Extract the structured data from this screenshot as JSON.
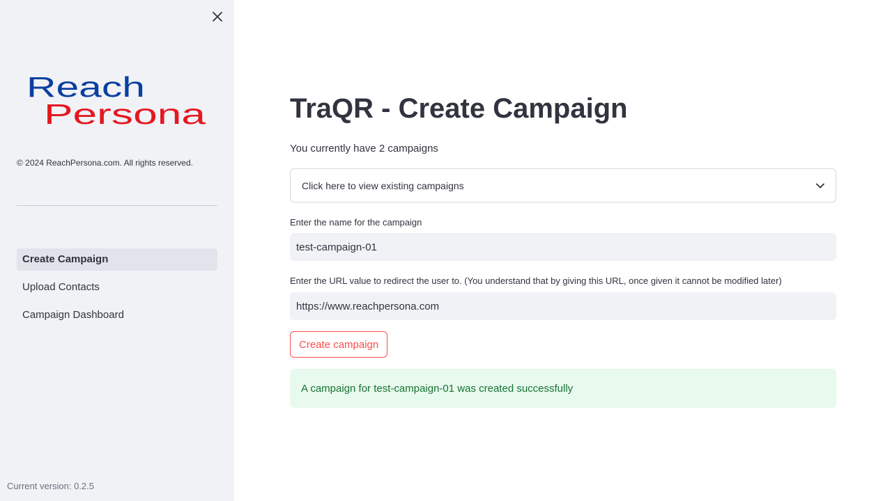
{
  "sidebar": {
    "logo": {
      "line1": "Reach",
      "line2": "Persona",
      "line1_color": "#0b3fa0",
      "line2_color": "#e5171f"
    },
    "close_icon": "close-icon",
    "copyright": "© 2024 ReachPersona.com. All rights reserved.",
    "nav_items": [
      {
        "label": "Create Campaign",
        "active": true
      },
      {
        "label": "Upload Contacts",
        "active": false
      },
      {
        "label": "Campaign Dashboard",
        "active": false
      }
    ],
    "version": "Current version: 0.2.5"
  },
  "main": {
    "title": "TraQR - Create Campaign",
    "subtitle": "You currently have 2 campaigns",
    "expander": {
      "label": "Click here to view existing campaigns",
      "icon": "chevron-down-icon"
    },
    "campaign_name": {
      "label": "Enter the name for the campaign",
      "value": "test-campaign-01"
    },
    "redirect_url": {
      "label": "Enter the URL value to redirect the user to. (You understand that by giving this URL, once given it cannot be modified later)",
      "value": "https://www.reachpersona.com"
    },
    "create_button": "Create campaign",
    "success_message": "A campaign for test-campaign-01 was created successfully"
  },
  "colors": {
    "accent": "#ff4b4b",
    "sidebar_bg": "#f0f2f6",
    "success_bg": "#e8f9ee",
    "success_text": "#177233"
  }
}
